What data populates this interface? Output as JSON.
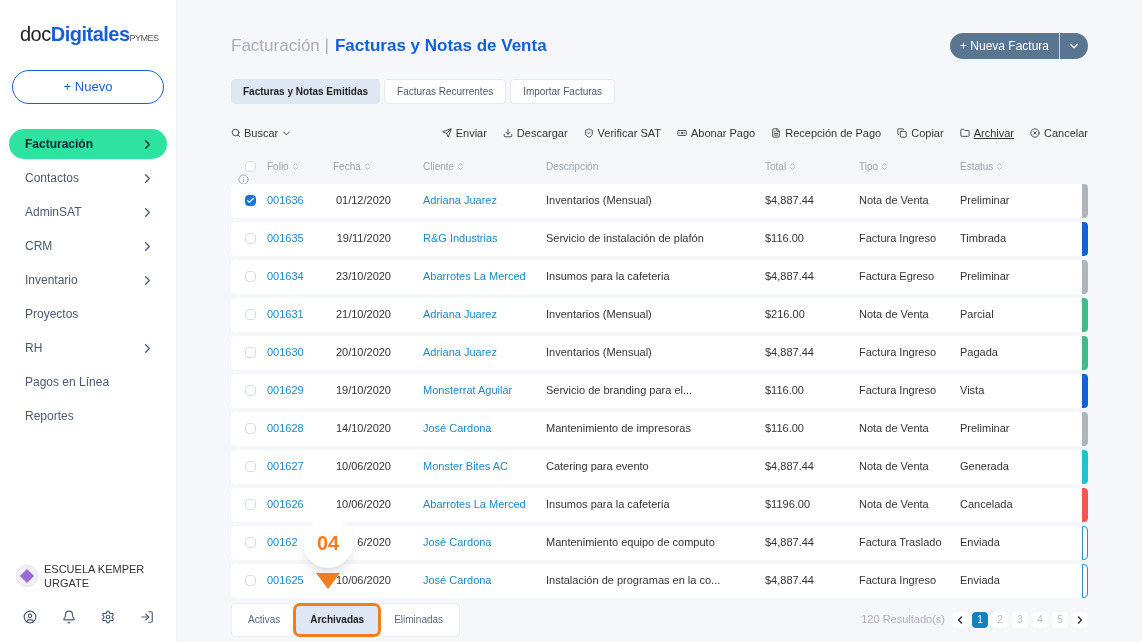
{
  "sidebar": {
    "logo": {
      "prefix": "doc",
      "brand": "Digitales",
      "suffix": "PYMES"
    },
    "new_button": "+ Nuevo",
    "items": [
      {
        "label": "Facturación",
        "selected": true,
        "has_arrow": true
      },
      {
        "label": "Contactos",
        "selected": false,
        "has_arrow": true
      },
      {
        "label": "AdminSAT",
        "selected": false,
        "has_arrow": true
      },
      {
        "label": "CRM",
        "selected": false,
        "has_arrow": true
      },
      {
        "label": "Inventario",
        "selected": false,
        "has_arrow": true
      },
      {
        "label": "Proyectos",
        "selected": false,
        "has_arrow": false
      },
      {
        "label": "RH",
        "selected": false,
        "has_arrow": true
      },
      {
        "label": "Pagos en Línea",
        "selected": false,
        "has_arrow": false
      },
      {
        "label": "Reportes",
        "selected": false,
        "has_arrow": false
      }
    ],
    "account": {
      "name": "ESCUELA KEMPER URGATE"
    }
  },
  "header": {
    "section": "Facturación |",
    "title": "Facturas y Notas de Venta",
    "primary_button": "+ Nueva Factura"
  },
  "tabs": [
    {
      "label": "Facturas y Notas Emitidas",
      "selected": true
    },
    {
      "label": "Facturas Recurrentes",
      "selected": false
    },
    {
      "label": "Importar Facturas",
      "selected": false
    }
  ],
  "toolbar": {
    "search": "Buscar",
    "actions": [
      {
        "label": "Enviar",
        "kind": "send"
      },
      {
        "label": "Descargar",
        "kind": "download"
      },
      {
        "label": "Verificar SAT",
        "kind": "shield"
      },
      {
        "label": "Abonar Pago",
        "kind": "money"
      },
      {
        "label": "Recepción de Pago",
        "kind": "doc"
      },
      {
        "label": "Copiar",
        "kind": "copy"
      },
      {
        "label": "Archivar",
        "kind": "folder"
      },
      {
        "label": "Cancelar",
        "kind": "cancel"
      }
    ]
  },
  "table": {
    "select_all": {
      "checked": false
    },
    "columns": [
      "Folio",
      "Fecha",
      "Cliente",
      "Descripción",
      "Total",
      "Tipo",
      "Estatus"
    ],
    "rows": [
      {
        "folio": "001636",
        "fecha": "01/12/2020",
        "cliente": "Adriana Juarez",
        "descripcion": "Inventarios (Mensual)",
        "total": "$4,887.44",
        "tipo": "Nota de Venta",
        "estatus": "Preliminar",
        "selected": true,
        "color": "#b0b4bb",
        "outlined": false
      },
      {
        "folio": "001635",
        "fecha": "19/11/2020",
        "cliente": "R&G Industrias",
        "descripcion": "Servicio de instalación de plafón",
        "total": "$116.00",
        "tipo": "Factura Ingreso",
        "estatus": "Timbrada",
        "selected": false,
        "color": "#1560d4",
        "outlined": false
      },
      {
        "folio": "001634",
        "fecha": "23/10/2020",
        "cliente": "Abarrotes La Merced",
        "descripcion": "Insumos para la cafeteria",
        "total": "$4,887.44",
        "tipo": "Factura Egreso",
        "estatus": "Preliminar",
        "selected": false,
        "color": "#b0b4bb",
        "outlined": false
      },
      {
        "folio": "001631",
        "fecha": "21/10/2020",
        "cliente": "Adriana Juarez",
        "descripcion": "Inventarios (Mensual)",
        "total": "$216.00",
        "tipo": "Nota de Venta",
        "estatus": "Parcial",
        "selected": false,
        "color": "#44b98a",
        "outlined": false
      },
      {
        "folio": "001630",
        "fecha": "20/10/2020",
        "cliente": "Adriana Juarez",
        "descripcion": "Inventarios (Mensual)",
        "total": "$4,887.44",
        "tipo": "Factura Ingreso",
        "estatus": "Pagada",
        "selected": false,
        "color": "#44b98a",
        "outlined": false
      },
      {
        "folio": "001629",
        "fecha": "19/10/2020",
        "cliente": "Monsterrat Aguilar",
        "descripcion": "Servicio de branding para el...",
        "total": "$116.00",
        "tipo": "Factura Ingreso",
        "estatus": "Vista",
        "selected": false,
        "color": "#1560d4",
        "outlined": false
      },
      {
        "folio": "001628",
        "fecha": "14/10/2020",
        "cliente": "José Cardona",
        "descripcion": "Mantenimiento de impresoras",
        "total": "$116.00",
        "tipo": "Nota de Venta",
        "estatus": "Preliminar",
        "selected": false,
        "color": "#b0b4bb",
        "outlined": false
      },
      {
        "folio": "001627",
        "fecha": "10/06/2020",
        "cliente": "Monster Bites AC",
        "descripcion": "Catering para evento",
        "total": "$4,887.44",
        "tipo": "Nota de Venta",
        "estatus": "Generada",
        "selected": false,
        "color": "#1fc3cf",
        "outlined": false
      },
      {
        "folio": "001626",
        "fecha": "10/06/2020",
        "cliente": "Abarrotes La Merced",
        "descripcion": "Insumos para la cafeteria",
        "total": "$1196.00",
        "tipo": "Nota de Venta",
        "estatus": "Cancelada",
        "selected": false,
        "color": "#f25656",
        "outlined": false
      },
      {
        "folio": "00162",
        "fecha": "6/2020",
        "cliente": "José Cardona",
        "descripcion": "Mantenimiento equipo de computo",
        "total": "$4,887.44",
        "tipo": "Factura Traslado",
        "estatus": "Enviada",
        "selected": false,
        "color": "#2b8fc9",
        "outlined": true
      },
      {
        "folio": "001625",
        "fecha": "10/06/2020",
        "cliente": "José Cardona",
        "descripcion": "Instalación de programas en la co...",
        "total": "$4,887.44",
        "tipo": "Factura Ingreso",
        "estatus": "Enviada",
        "selected": false,
        "color": "#2b8fc9",
        "outlined": true
      }
    ]
  },
  "filters": [
    {
      "label": "Activas",
      "selected": false,
      "highlighted": false
    },
    {
      "label": "Archivadas",
      "selected": true,
      "highlighted": true
    },
    {
      "label": "Eliminadas",
      "selected": false,
      "highlighted": false
    }
  ],
  "callout": {
    "label": "04"
  },
  "pagination": {
    "results": "120 Resultado(s)",
    "pages": [
      {
        "label": "1",
        "selected": true
      },
      {
        "label": "2",
        "selected": false
      },
      {
        "label": "3",
        "selected": false
      },
      {
        "label": "4",
        "selected": false
      },
      {
        "label": "5",
        "selected": false
      }
    ]
  }
}
